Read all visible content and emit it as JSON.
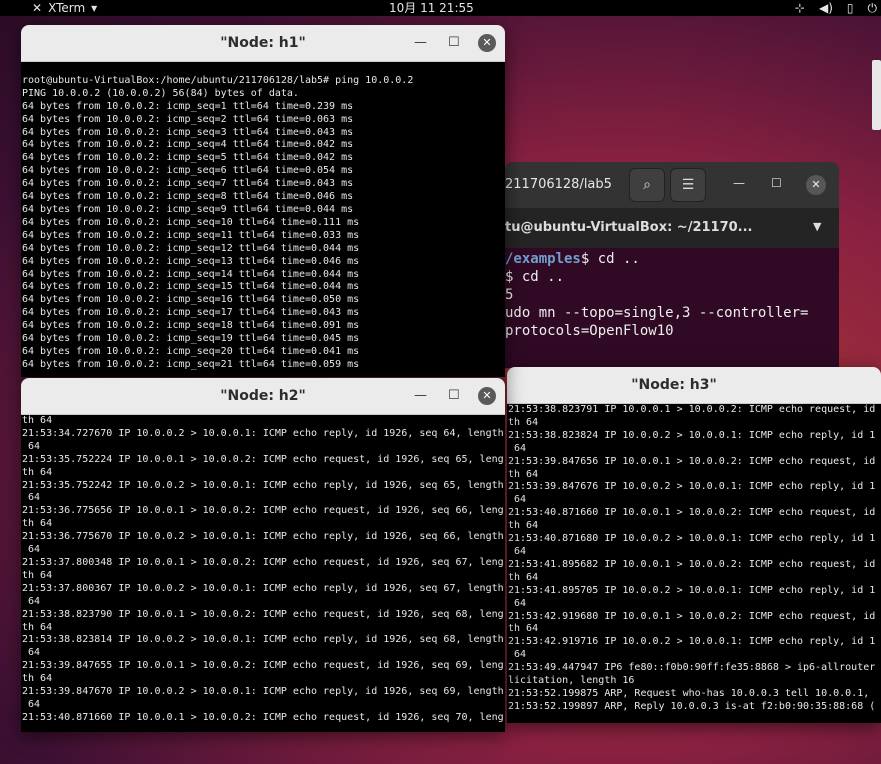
{
  "topbar": {
    "app_name": "XTerm",
    "clock": "10月 11  21:55"
  },
  "h1": {
    "title": "\"Node: h1\"",
    "lines": [
      "",
      "root@ubuntu-VirtualBox:/home/ubuntu/211706128/lab5# ping 10.0.0.2",
      "PING 10.0.0.2 (10.0.0.2) 56(84) bytes of data.",
      "64 bytes from 10.0.0.2: icmp_seq=1 ttl=64 time=0.239 ms",
      "64 bytes from 10.0.0.2: icmp_seq=2 ttl=64 time=0.063 ms",
      "64 bytes from 10.0.0.2: icmp_seq=3 ttl=64 time=0.043 ms",
      "64 bytes from 10.0.0.2: icmp_seq=4 ttl=64 time=0.042 ms",
      "64 bytes from 10.0.0.2: icmp_seq=5 ttl=64 time=0.042 ms",
      "64 bytes from 10.0.0.2: icmp_seq=6 ttl=64 time=0.054 ms",
      "64 bytes from 10.0.0.2: icmp_seq=7 ttl=64 time=0.043 ms",
      "64 bytes from 10.0.0.2: icmp_seq=8 ttl=64 time=0.046 ms",
      "64 bytes from 10.0.0.2: icmp_seq=9 ttl=64 time=0.044 ms",
      "64 bytes from 10.0.0.2: icmp_seq=10 ttl=64 time=0.111 ms",
      "64 bytes from 10.0.0.2: icmp_seq=11 ttl=64 time=0.033 ms",
      "64 bytes from 10.0.0.2: icmp_seq=12 ttl=64 time=0.044 ms",
      "64 bytes from 10.0.0.2: icmp_seq=13 ttl=64 time=0.046 ms",
      "64 bytes from 10.0.0.2: icmp_seq=14 ttl=64 time=0.044 ms",
      "64 bytes from 10.0.0.2: icmp_seq=15 ttl=64 time=0.044 ms",
      "64 bytes from 10.0.0.2: icmp_seq=16 ttl=64 time=0.050 ms",
      "64 bytes from 10.0.0.2: icmp_seq=17 ttl=64 time=0.043 ms",
      "64 bytes from 10.0.0.2: icmp_seq=18 ttl=64 time=0.091 ms",
      "64 bytes from 10.0.0.2: icmp_seq=19 ttl=64 time=0.045 ms",
      "64 bytes from 10.0.0.2: icmp_seq=20 ttl=64 time=0.041 ms",
      "64 bytes from 10.0.0.2: icmp_seq=21 ttl=64 time=0.059 ms"
    ]
  },
  "h2": {
    "title": "\"Node: h2\"",
    "lines": [
      "th 64",
      "21:53:34.727670 IP 10.0.0.2 > 10.0.0.1: ICMP echo reply, id 1926, seq 64, length",
      " 64",
      "21:53:35.752224 IP 10.0.0.1 > 10.0.0.2: ICMP echo request, id 1926, seq 65, leng",
      "th 64",
      "21:53:35.752242 IP 10.0.0.2 > 10.0.0.1: ICMP echo reply, id 1926, seq 65, length",
      " 64",
      "21:53:36.775656 IP 10.0.0.1 > 10.0.0.2: ICMP echo request, id 1926, seq 66, leng",
      "th 64",
      "21:53:36.775670 IP 10.0.0.2 > 10.0.0.1: ICMP echo reply, id 1926, seq 66, length",
      " 64",
      "21:53:37.800348 IP 10.0.0.1 > 10.0.0.2: ICMP echo request, id 1926, seq 67, leng",
      "th 64",
      "21:53:37.800367 IP 10.0.0.2 > 10.0.0.1: ICMP echo reply, id 1926, seq 67, length",
      " 64",
      "21:53:38.823790 IP 10.0.0.1 > 10.0.0.2: ICMP echo request, id 1926, seq 68, leng",
      "th 64",
      "21:53:38.823814 IP 10.0.0.2 > 10.0.0.1: ICMP echo reply, id 1926, seq 68, length",
      " 64",
      "21:53:39.847655 IP 10.0.0.1 > 10.0.0.2: ICMP echo request, id 1926, seq 69, leng",
      "th 64",
      "21:53:39.847670 IP 10.0.0.2 > 10.0.0.1: ICMP echo reply, id 1926, seq 69, length",
      " 64",
      "21:53:40.871660 IP 10.0.0.1 > 10.0.0.2: ICMP echo request, id 1926, seq 70, leng"
    ]
  },
  "h3": {
    "title": "\"Node: h3\"",
    "lines": [
      "21:53:38.823791 IP 10.0.0.1 > 10.0.0.2: ICMP echo request, id",
      "th 64",
      "21:53:38.823824 IP 10.0.0.2 > 10.0.0.1: ICMP echo reply, id 1",
      " 64",
      "21:53:39.847656 IP 10.0.0.1 > 10.0.0.2: ICMP echo request, id",
      "th 64",
      "21:53:39.847676 IP 10.0.0.2 > 10.0.0.1: ICMP echo reply, id 1",
      " 64",
      "21:53:40.871660 IP 10.0.0.1 > 10.0.0.2: ICMP echo request, id",
      "th 64",
      "21:53:40.871680 IP 10.0.0.2 > 10.0.0.1: ICMP echo reply, id 1",
      " 64",
      "21:53:41.895682 IP 10.0.0.1 > 10.0.0.2: ICMP echo request, id",
      "th 64",
      "21:53:41.895705 IP 10.0.0.2 > 10.0.0.1: ICMP echo reply, id 1",
      " 64",
      "21:53:42.919680 IP 10.0.0.1 > 10.0.0.2: ICMP echo request, id",
      "th 64",
      "21:53:42.919716 IP 10.0.0.2 > 10.0.0.1: ICMP echo reply, id 1",
      " 64",
      "21:53:49.447947 IP6 fe80::f0b0:90ff:fe35:8868 > ip6-allrouter",
      "licitation, length 16",
      "21:53:52.199875 ARP, Request who-has 10.0.0.3 tell 10.0.0.1,",
      "21:53:52.199897 ARP, Reply 10.0.0.3 is-at f2:b0:90:35:88:68 ("
    ]
  },
  "gnome_terminal": {
    "title": "211706128/lab5",
    "tab_label": "tu@ubuntu-VirtualBox: ~/21170...",
    "line1_path": "/examples",
    "line1_cmd": "$ cd ..",
    "line2": "$ cd ..",
    "line3": "5",
    "line4": "udo mn --topo=single,3 --controller=",
    "line5": "protocols=OpenFlow10"
  },
  "icons": [
    "xterm-icon",
    "chevron-down-icon",
    "network-icon",
    "volume-icon",
    "battery-icon",
    "power-icon",
    "minimize-icon",
    "maximize-icon",
    "close-icon",
    "search-icon",
    "hamburger-menu-icon"
  ]
}
